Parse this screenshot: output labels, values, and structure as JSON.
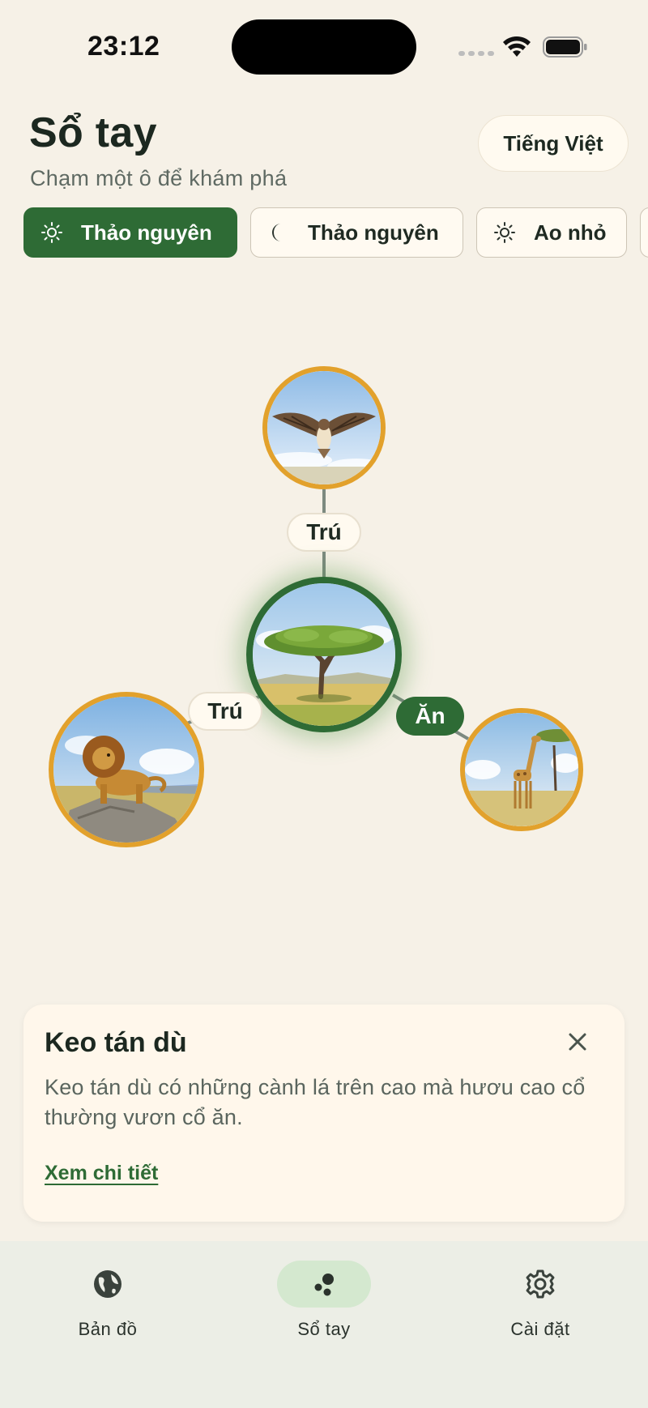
{
  "status_bar": {
    "time": "23:12"
  },
  "header": {
    "title": "Sổ tay",
    "subtitle": "Chạm một ô để khám phá",
    "language_button": "Tiếng Việt"
  },
  "filters": [
    {
      "label": "Thảo nguyên",
      "icon": "sun-icon",
      "active": true
    },
    {
      "label": "Thảo nguyên",
      "icon": "moon-icon",
      "active": false
    },
    {
      "label": "Ao nhỏ",
      "icon": "sun-icon",
      "active": false
    }
  ],
  "food_web": {
    "center": {
      "name": "acacia-tree"
    },
    "links": [
      {
        "animal": "hawk",
        "label": "Trú"
      },
      {
        "animal": "lion",
        "label": "Trú"
      },
      {
        "animal": "giraffe",
        "label": "Ăn"
      }
    ]
  },
  "info_card": {
    "title": "Keo tán dù",
    "description": "Keo tán dù có những cành lá trên cao mà hươu cao cổ thường vươn cổ ăn.",
    "link": "Xem chi tiết"
  },
  "nav": {
    "items": [
      {
        "label": "Bản đồ",
        "icon": "globe-icon"
      },
      {
        "label": "Sổ tay",
        "icon": "notebook-dots-icon",
        "active": true
      },
      {
        "label": "Cài đặt",
        "icon": "gear-icon"
      }
    ]
  },
  "colors": {
    "accent_green": "#2e6b35",
    "ring_orange": "#e2a12c",
    "background": "#f6f1e7"
  }
}
